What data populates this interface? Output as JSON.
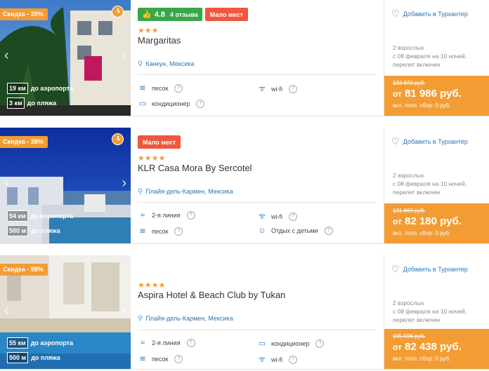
{
  "hotels": [
    {
      "discount": "Скидка - 39%",
      "rating": "4.8",
      "reviews": "4 отзыва",
      "few_places": "Мало мест",
      "stars": "★★★",
      "name": "Margaritas",
      "location": "Канкун, Мексика",
      "dist_airport_val": "19 км",
      "dist_airport_lbl": "до аэропорта",
      "dist_beach_val": "3 км",
      "dist_beach_lbl": "до пляжа",
      "features": [
        {
          "icon": "sand-icon",
          "label": "песок"
        },
        {
          "icon": "wifi-icon",
          "label": "wi-fi"
        },
        {
          "icon": "ac-icon",
          "label": "кондиционер"
        }
      ],
      "fav": "Добавить в Турхантер",
      "pax1": "2 взрослых",
      "pax2": "с 08 февраля на 10 ночей,",
      "pax3": "перелет включен",
      "old_price": "133 872 руб.",
      "price_prefix": "от",
      "price": "81 986 руб.",
      "fee": "вкл. топл. сбор: 0 руб."
    },
    {
      "discount": "Скидка - 38%",
      "few_places": "Мало мест",
      "stars": "★★★★",
      "name": "KLR Casa Mora By Sercotel",
      "location": "Плайя-дель-Кармен, Мексика",
      "dist_airport_val": "54 км",
      "dist_airport_lbl": "до аэропорта",
      "dist_beach_val": "500 м",
      "dist_beach_lbl": "до пляжа",
      "features": [
        {
          "icon": "waves-icon",
          "label": "2-я линия"
        },
        {
          "icon": "wifi-icon",
          "label": "wi-fi"
        },
        {
          "icon": "sand-icon",
          "label": "песок"
        },
        {
          "icon": "kids-icon",
          "label": "Отдых с детьми"
        }
      ],
      "fav": "Добавить в Турхантер",
      "pax1": "2 взрослых",
      "pax2": "с 08 февраля на 10 ночей,",
      "pax3": "перелет включен",
      "old_price": "131 869 руб.",
      "price_prefix": "от",
      "price": "82 180 руб.",
      "fee": "вкл. топл. сбор: 0 руб."
    },
    {
      "discount": "Скидка - 58%",
      "stars": "★★★★",
      "name": "Aspira Hotel & Beach Club by Tukan",
      "location": "Плайя-дель-Кармен, Мексика",
      "dist_airport_val": "55 км",
      "dist_airport_lbl": "до аэропорта",
      "dist_beach_val": "500 м",
      "dist_beach_lbl": "до пляжа",
      "features": [
        {
          "icon": "waves-icon",
          "label": "2-я линия"
        },
        {
          "icon": "ac-icon",
          "label": "кондиционер"
        },
        {
          "icon": "sand-icon",
          "label": "песок"
        },
        {
          "icon": "wifi-icon",
          "label": "wi-fi"
        }
      ],
      "fav": "Добавить в Турхантер",
      "pax1": "2 взрослых",
      "pax2": "с 08 февраля на 10 ночей,",
      "pax3": "перелет включен",
      "old_price": "195 596 руб.",
      "price_prefix": "от",
      "price": "82 438 руб.",
      "fee": "вкл. топл. сбор: 0 руб."
    }
  ],
  "colors": {
    "accent_orange": "#f39c33",
    "badge_red": "#f1573e",
    "rating_green": "#3aa648",
    "link_blue": "#2a76b8"
  }
}
